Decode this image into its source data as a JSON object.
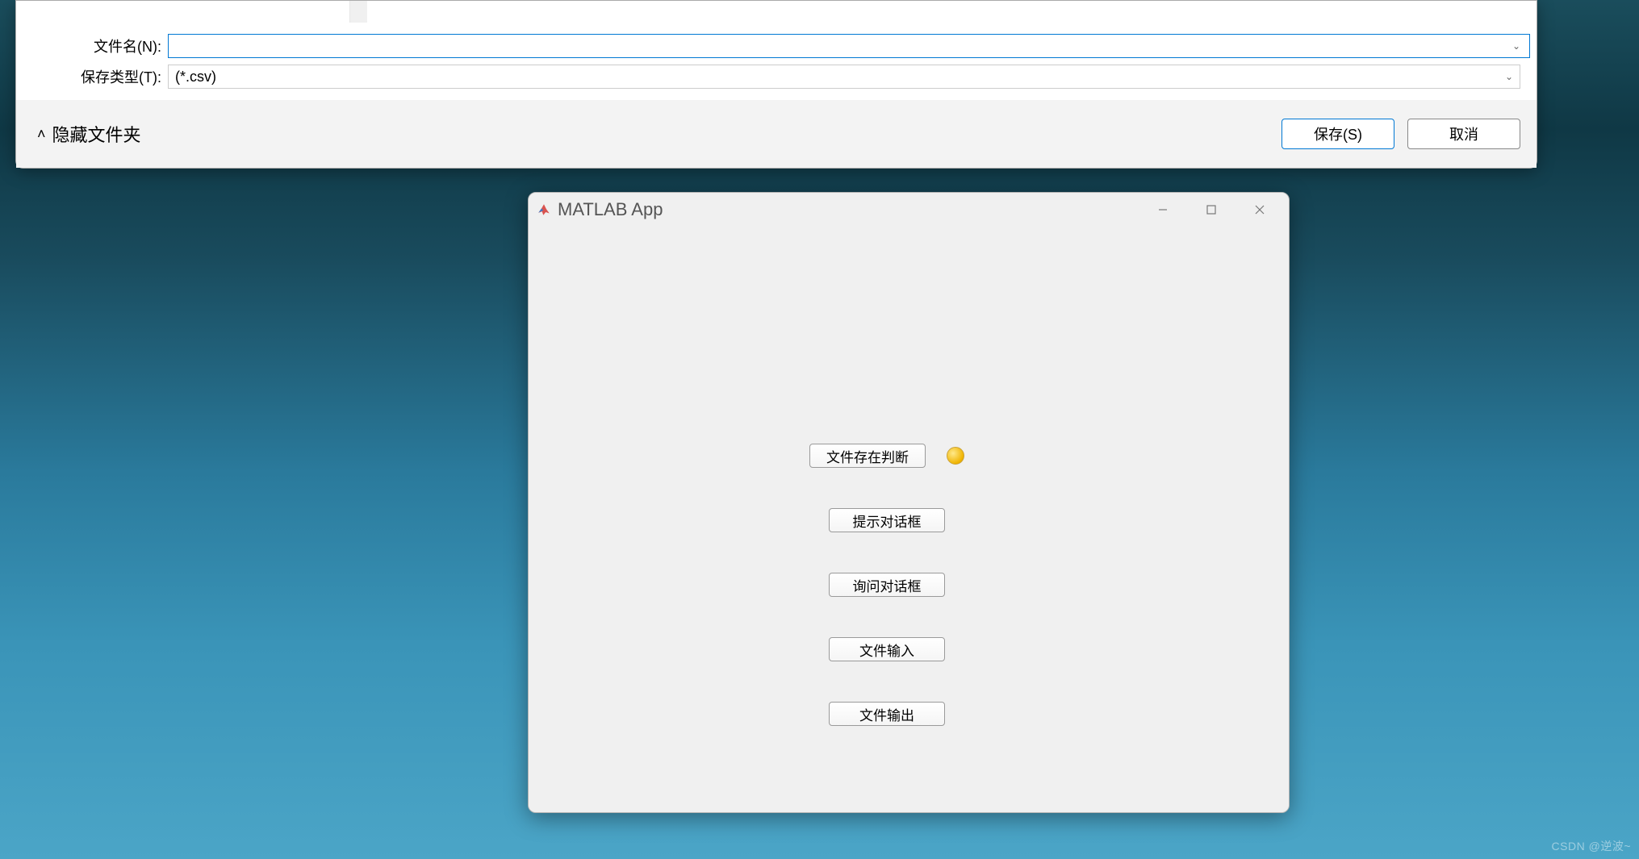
{
  "save_dialog": {
    "filename_label": "文件名(N):",
    "filename_value": "",
    "filetype_label": "保存类型(T):",
    "filetype_value": "(*.csv)",
    "hide_folders_label": "隐藏文件夹",
    "save_btn": "保存(S)",
    "cancel_btn": "取消"
  },
  "app_window": {
    "title": "MATLAB App",
    "buttons": {
      "file_exist": "文件存在判断",
      "alert_dialog": "提示对话框",
      "ask_dialog": "询问对话框",
      "file_input": "文件输入",
      "file_output": "文件输出"
    }
  },
  "watermark": "CSDN @逆波~"
}
